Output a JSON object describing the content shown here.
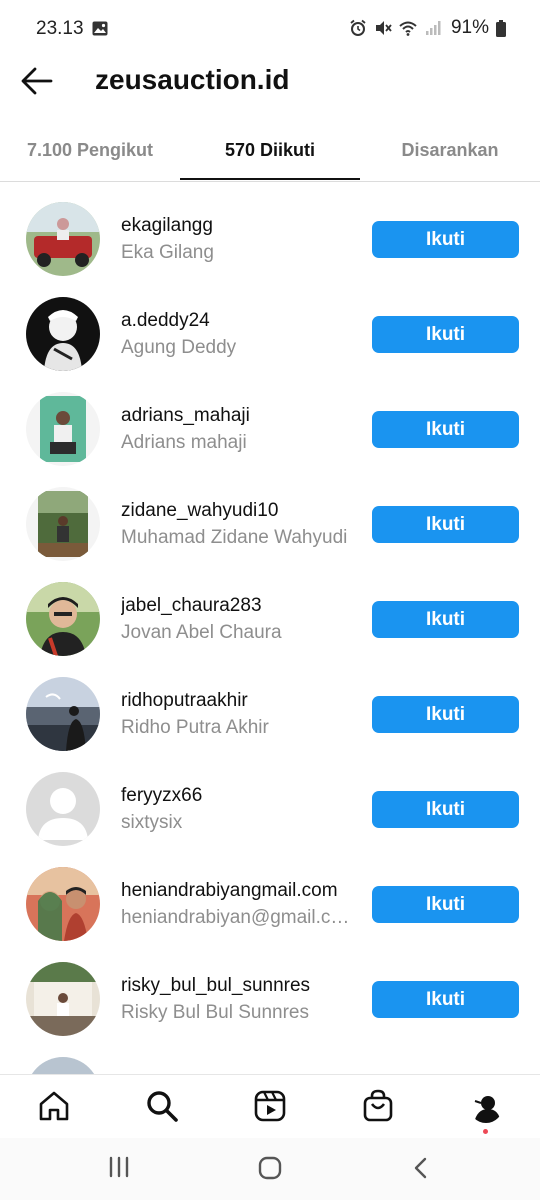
{
  "status_bar": {
    "time": "23.13",
    "battery": "91%",
    "icons": [
      "gallery-icon",
      "alarm-icon",
      "mute-icon",
      "wifi-icon",
      "signal-icon",
      "battery-icon"
    ]
  },
  "header": {
    "title": "zeusauction.id",
    "back_icon": "arrow-left-icon"
  },
  "tabs": [
    {
      "label": "7.100 Pengikut",
      "active": false
    },
    {
      "label": "570 Diikuti",
      "active": true
    },
    {
      "label": "Disarankan",
      "active": false
    }
  ],
  "accounts": [
    {
      "username": "ekagilangg",
      "name": "Eka Gilang",
      "button": "Ikuti"
    },
    {
      "username": "a.deddy24",
      "name": "Agung Deddy",
      "button": "Ikuti"
    },
    {
      "username": "adrians_mahaji",
      "name": "Adrians mahaji",
      "button": "Ikuti"
    },
    {
      "username": "zidane_wahyudi10",
      "name": "Muhamad Zidane Wahyudi",
      "button": "Ikuti"
    },
    {
      "username": "jabel_chaura283",
      "name": "Jovan Abel Chaura",
      "button": "Ikuti"
    },
    {
      "username": "ridhoputraakhir",
      "name": "Ridho Putra Akhir",
      "button": "Ikuti"
    },
    {
      "username": "feryyzx66",
      "name": "sixtysix",
      "button": "Ikuti"
    },
    {
      "username": "heniandrabiyangmail.com",
      "name": "heniandrabiyan@gmail.com",
      "button": "Ikuti"
    },
    {
      "username": "risky_bul_bul_sunnres",
      "name": "Risky Bul Bul Sunnres",
      "button": "Ikuti"
    }
  ],
  "bottom_nav": [
    "home-icon",
    "search-icon",
    "reels-icon",
    "shop-icon",
    "profile-avatar"
  ],
  "colors": {
    "follow_button": "#1a94f0",
    "notification_dot": "#ed4956"
  }
}
